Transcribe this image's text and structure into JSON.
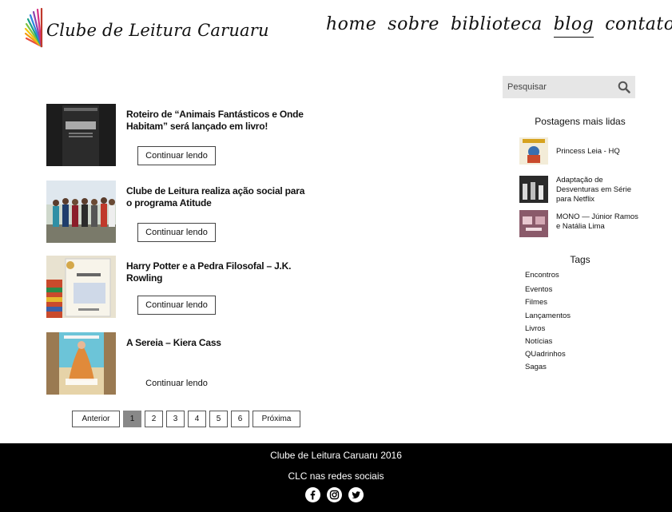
{
  "header": {
    "logo_text": "Clube de Leitura  Caruaru",
    "nav": [
      {
        "label": "home",
        "active": false
      },
      {
        "label": "sobre",
        "active": false
      },
      {
        "label": "biblioteca",
        "active": false
      },
      {
        "label": "blog",
        "active": true
      },
      {
        "label": "contato",
        "active": false
      }
    ]
  },
  "posts": [
    {
      "title": "Roteiro de “Animais Fantásticos e Onde Habitam” será lançado em livro!",
      "button": "Continuar lendo",
      "thumb_icon": "fantastic-beasts-book-cover"
    },
    {
      "title": "Clube de Leitura realiza ação social para o programa Atitude",
      "button": "Continuar lendo",
      "thumb_icon": "group-photo"
    },
    {
      "title": "Harry Potter e a Pedra Filosofal – J.K. Rowling",
      "button": "Continuar lendo",
      "thumb_icon": "harry-potter-book"
    },
    {
      "title": "A Sereia – Kiera Cass",
      "button": "Continuar lendo",
      "thumb_icon": "a-sereia-book-cover"
    }
  ],
  "pagination": {
    "prev": "Anterior",
    "pages": [
      "1",
      "2",
      "3",
      "4",
      "5",
      "6"
    ],
    "current": "1",
    "next": "Próxima"
  },
  "sidebar": {
    "search_placeholder": "Pesquisar",
    "popular_heading": "Postagens mais lidas",
    "popular": [
      {
        "title": "Princess Leia - HQ"
      },
      {
        "title": "Adaptação de Desventuras em Série para Netflix"
      },
      {
        "title": "MONO — Júnior Ramos e Natália Lima"
      }
    ],
    "tags_heading": "Tags",
    "tags": [
      "Encontros",
      "Eventos",
      "Filmes",
      "Lançamentos",
      "Livros",
      "Notícias",
      "QUadrinhos",
      "Sagas"
    ]
  },
  "footer": {
    "copyright": "Clube de Leitura Caruaru 2016",
    "social_label": "CLC nas redes sociais",
    "socials": [
      "facebook-icon",
      "instagram-icon",
      "twitter-icon"
    ]
  },
  "colors": {
    "footer_bg": "#000000",
    "search_bg": "#e6e6e6",
    "active_page_bg": "#888888"
  }
}
